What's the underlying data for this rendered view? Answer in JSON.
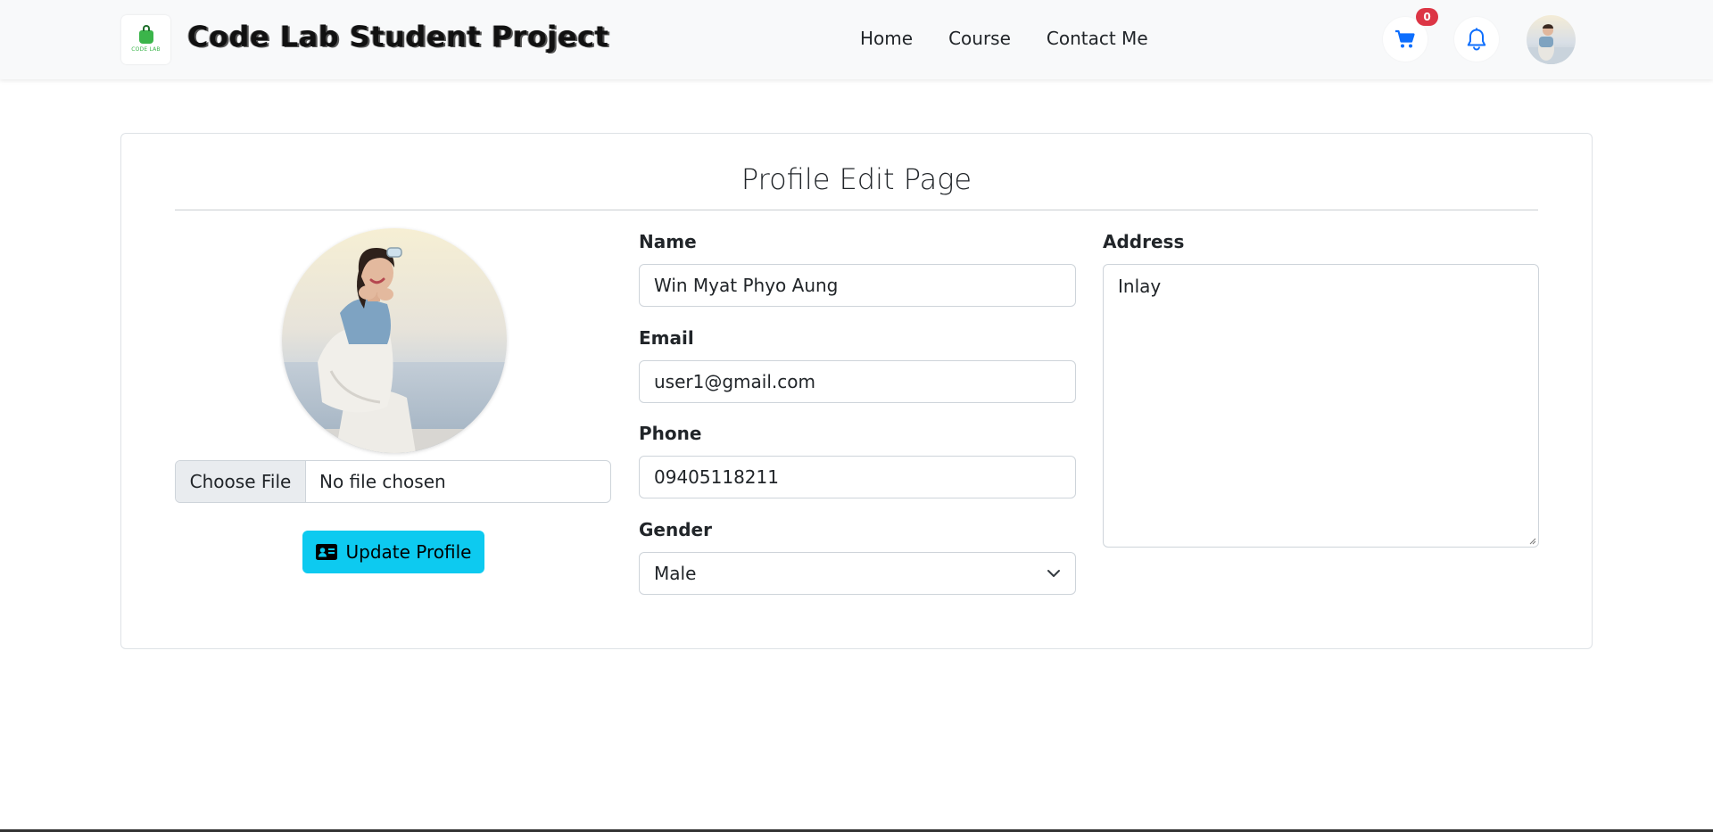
{
  "navbar": {
    "logo_text": "CODE LAB",
    "brand_title": "Code Lab Student Project",
    "links": [
      "Home",
      "Course",
      "Contact Me"
    ],
    "cart_count": "0",
    "icons": {
      "cart": "shopping-cart-icon",
      "bell": "bell-icon",
      "avatar": "user-avatar"
    }
  },
  "page": {
    "title": "Profile Edit Page"
  },
  "profile": {
    "file_button_label": "Choose File",
    "file_status": "No file chosen",
    "update_button_label": "Update Profile",
    "update_button_icon": "id-card-icon"
  },
  "form": {
    "name_label": "Name",
    "name_value": "Win Myat Phyo Aung",
    "email_label": "Email",
    "email_value": "user1@gmail.com",
    "phone_label": "Phone",
    "phone_value": "09405118211",
    "gender_label": "Gender",
    "gender_value": "Male",
    "address_label": "Address",
    "address_value": "Inlay"
  },
  "colors": {
    "navbar_bg": "#f8f9fa",
    "accent_blue": "#0d6efd",
    "badge_red": "#dc3545",
    "update_button_bg": "#0dcaf0"
  }
}
